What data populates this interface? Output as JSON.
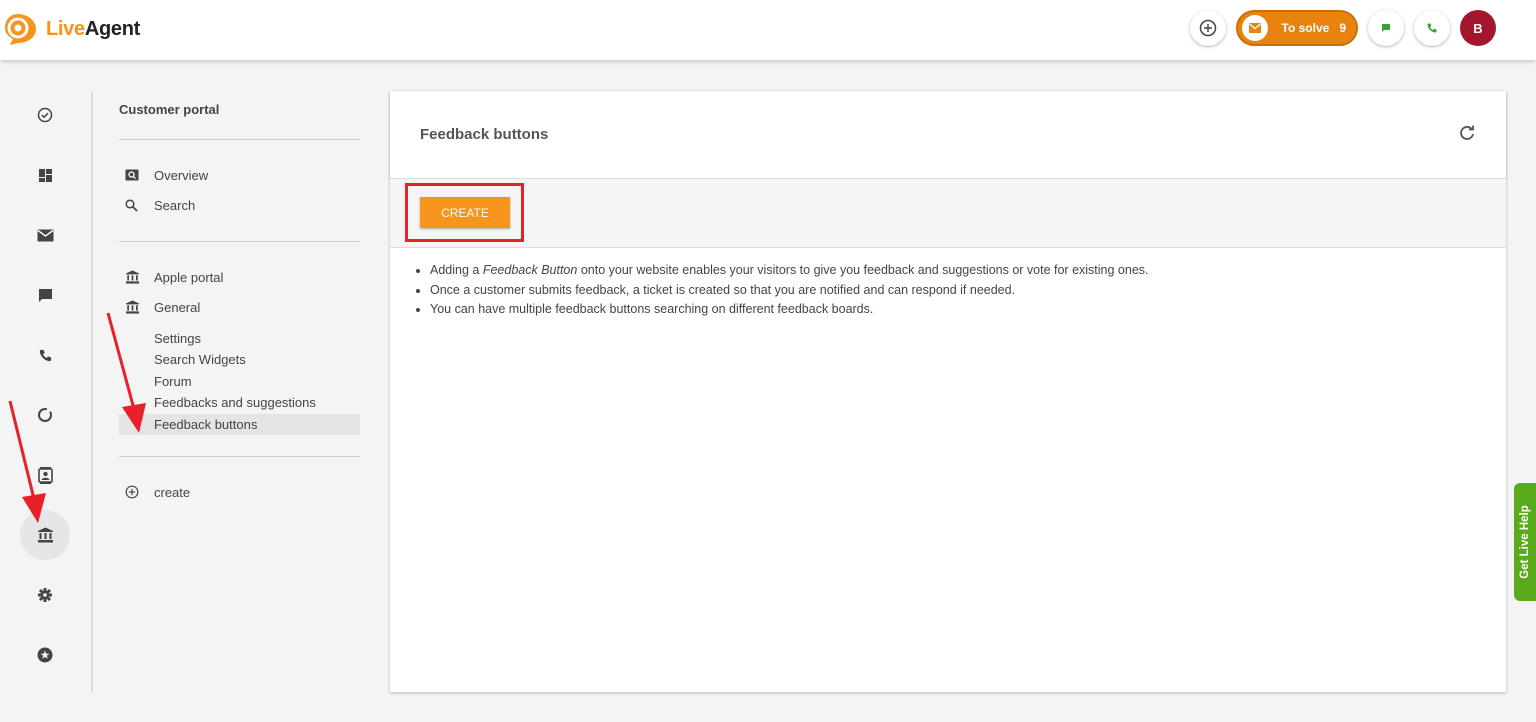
{
  "app": {
    "logo_live": "Live",
    "logo_agent": "Agent",
    "brand_color": "#f7941d"
  },
  "header": {
    "add_icon": "plus-circle-icon",
    "to_solve_label": "To solve",
    "to_solve_count": "9",
    "avatar_initial": "B",
    "avatar_color": "#a3162b"
  },
  "left_nav": {
    "items": [
      {
        "icon": "check-circle-icon"
      },
      {
        "icon": "dashboard-icon"
      },
      {
        "icon": "mail-icon"
      },
      {
        "icon": "chat-icon"
      },
      {
        "icon": "phone-icon"
      },
      {
        "icon": "reports-icon"
      },
      {
        "icon": "contacts-icon"
      },
      {
        "icon": "bank-icon",
        "active": true
      },
      {
        "icon": "settings-icon"
      },
      {
        "icon": "star-icon"
      }
    ]
  },
  "submenu": {
    "title": "Customer portal",
    "top_items": [
      {
        "label": "Overview",
        "icon": "overview-icon"
      },
      {
        "label": "Search",
        "icon": "search-icon"
      }
    ],
    "portals": [
      {
        "label": "Apple portal",
        "icon": "bank-icon"
      },
      {
        "label": "General",
        "icon": "bank-icon"
      }
    ],
    "general_items": [
      {
        "label": "Settings"
      },
      {
        "label": "Search Widgets"
      },
      {
        "label": "Forum"
      },
      {
        "label": "Feedbacks and suggestions"
      },
      {
        "label": "Feedback buttons",
        "selected": true
      }
    ],
    "create_label": "create"
  },
  "main": {
    "title": "Feedback buttons",
    "create_button": "CREATE",
    "info": {
      "line1_pre": "Adding a ",
      "line1_em": "Feedback Button",
      "line1_post": " onto your website enables your visitors to give you feedback and suggestions or vote for existing ones.",
      "line2": "Once a customer submits feedback, a ticket is created so that you are notified and can respond if needed.",
      "line3": "You can have multiple feedback buttons searching on different feedback boards."
    }
  },
  "live_help": {
    "label": "Get Live Help",
    "color": "#5aaa1e"
  }
}
